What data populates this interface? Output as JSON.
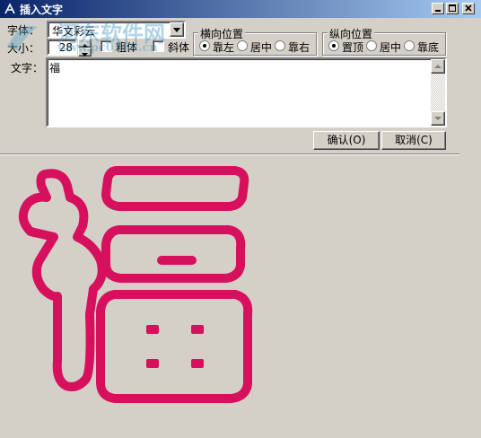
{
  "window": {
    "title": "插入文字",
    "icon": "app-a-icon",
    "buttons": [
      "minimize-icon",
      "maximize-icon",
      "close-icon"
    ]
  },
  "font": {
    "label": "字体：",
    "value": "华文彩云",
    "size_label": "大小：",
    "size_value": "28",
    "bold_label": "粗体",
    "italic_label": "斜体"
  },
  "horizontal": {
    "title": "横向位置",
    "options": [
      "靠左",
      "居中",
      "靠右"
    ],
    "selected": "靠左"
  },
  "vertical": {
    "title": "纵向位置",
    "options": [
      "置顶",
      "居中",
      "靠底"
    ],
    "selected": "置顶"
  },
  "text": {
    "label": "文字：",
    "value": "福"
  },
  "actions": {
    "ok_label": "确认(O)",
    "cancel_label": "取消(C)"
  },
  "preview": {
    "character": "福",
    "color": "#d6105c"
  },
  "watermark": {
    "line1": "河东软件网",
    "line2": "www.pc0359.cn"
  }
}
